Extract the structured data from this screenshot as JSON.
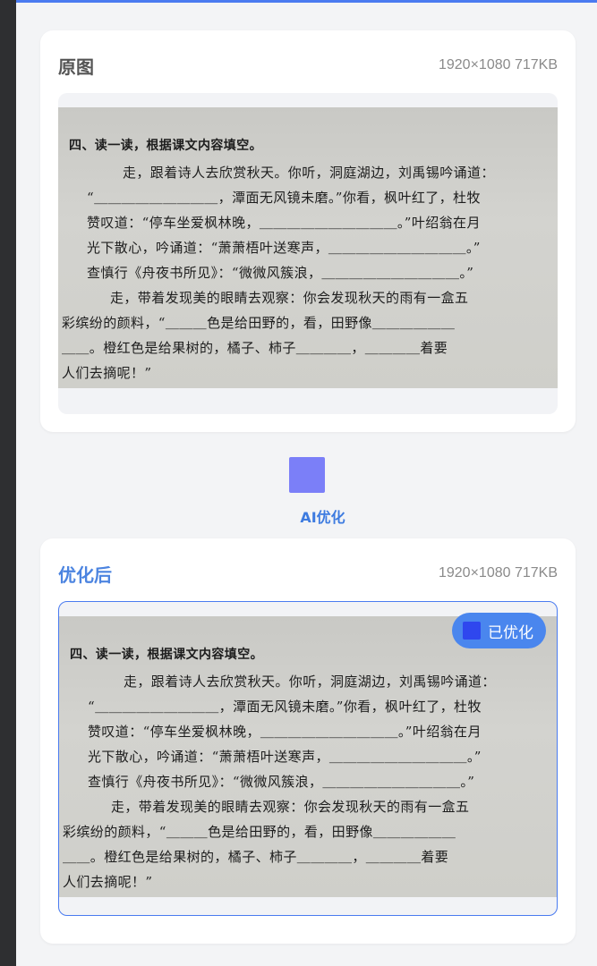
{
  "original": {
    "title": "原图",
    "meta": "1920×1080 717KB"
  },
  "ai": {
    "label": "AI优化"
  },
  "optimized": {
    "title": "优化后",
    "meta": "1920×1080 717KB",
    "badge": "已优化"
  },
  "page_text": {
    "heading": "四、读一读，根据课文内容填空。",
    "lines": [
      "走，跟着诗人去欣赏秋天。你听，洞庭湖边，刘禹锡吟诵道：",
      "“＿＿＿＿＿＿＿＿＿，潭面无风镜未磨。”你看，枫叶红了，杜牧",
      "赞叹道：“停车坐爱枫林晚，＿＿＿＿＿＿＿＿＿＿。”叶绍翁在月",
      "光下散心，吟诵道：“萧萧梧叶送寒声，＿＿＿＿＿＿＿＿＿＿。”",
      "查慎行《舟夜书所见》：“微微风簇浪，＿＿＿＿＿＿＿＿＿＿。”",
      "走，带着发现美的眼睛去观察：你会发现秋天的雨有一盒五",
      "彩缤纷的颜料，“＿＿＿色是给田野的，看，田野像＿＿＿＿＿＿",
      "＿＿。橙红色是给果树的，橘子、柿子＿＿＿＿，＿＿＿＿着要",
      "人们去摘呢！”"
    ]
  }
}
